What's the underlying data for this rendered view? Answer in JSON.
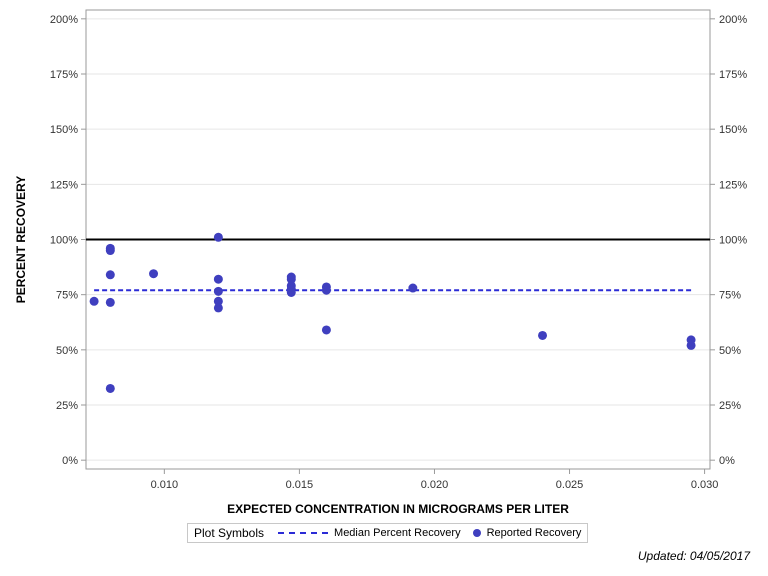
{
  "chart_data": {
    "type": "scatter",
    "title": "",
    "xlabel": "EXPECTED CONCENTRATION IN MICROGRAMS PER LITER",
    "ylabel": "PERCENT RECOVERY",
    "xlim": [
      0.0071,
      0.0302
    ],
    "ylim": [
      -4,
      204
    ],
    "x_ticks": [
      0.01,
      0.015,
      0.02,
      0.025,
      0.03
    ],
    "x_tick_labels": [
      "0.010",
      "0.015",
      "0.020",
      "0.025",
      "0.030"
    ],
    "y_ticks": [
      0,
      25,
      50,
      75,
      100,
      125,
      150,
      175,
      200
    ],
    "y_tick_labels": [
      "0%",
      "25%",
      "50%",
      "75%",
      "100%",
      "125%",
      "150%",
      "175%",
      "200%"
    ],
    "grid": true,
    "reference_line": {
      "y": 100,
      "color": "#000000"
    },
    "median_line": {
      "name": "Median Percent Recovery",
      "y": 77,
      "x_range": [
        0.0074,
        0.0295
      ],
      "color": "#2b2bd6"
    },
    "series": [
      {
        "name": "Reported Recovery",
        "color": "#3f3fbf",
        "points": [
          [
            0.0074,
            72
          ],
          [
            0.008,
            96
          ],
          [
            0.008,
            95
          ],
          [
            0.008,
            84
          ],
          [
            0.008,
            71.5
          ],
          [
            0.008,
            32.5
          ],
          [
            0.0096,
            84.5
          ],
          [
            0.012,
            101
          ],
          [
            0.012,
            82
          ],
          [
            0.012,
            76.5
          ],
          [
            0.012,
            72
          ],
          [
            0.012,
            69
          ],
          [
            0.0147,
            83
          ],
          [
            0.0147,
            82
          ],
          [
            0.0147,
            79
          ],
          [
            0.0147,
            77.5
          ],
          [
            0.0147,
            76
          ],
          [
            0.016,
            78.5
          ],
          [
            0.016,
            77
          ],
          [
            0.016,
            59
          ],
          [
            0.0192,
            78
          ],
          [
            0.024,
            56.5
          ],
          [
            0.0295,
            54.5
          ],
          [
            0.0295,
            52
          ]
        ]
      }
    ]
  },
  "legend": {
    "title": "Plot Symbols",
    "median_label": "Median Percent Recovery",
    "reported_label": "Reported Recovery"
  },
  "footer": {
    "updated": "Updated: 04/05/2017"
  }
}
